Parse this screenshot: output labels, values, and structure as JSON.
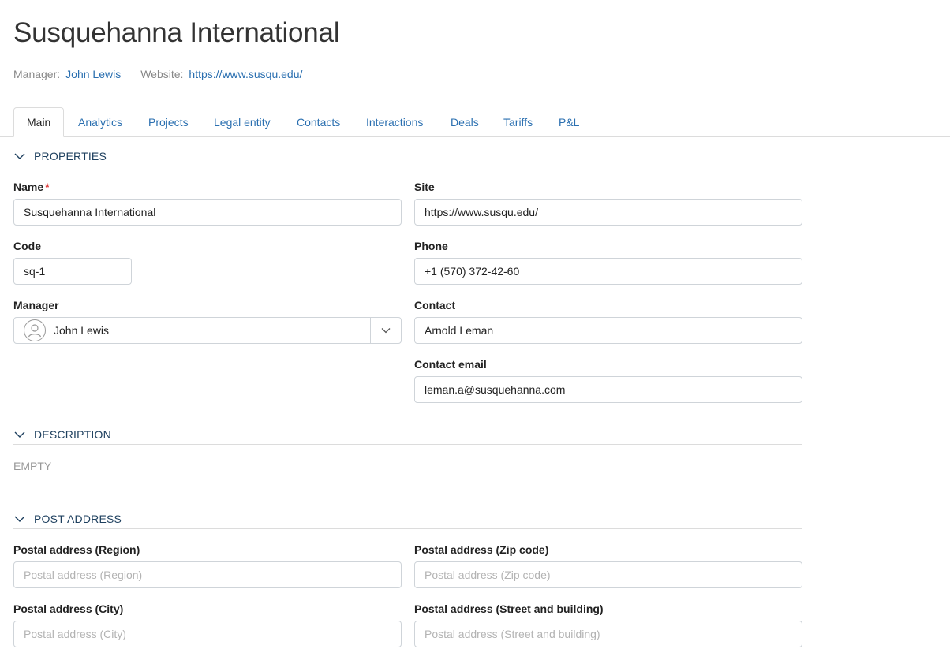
{
  "header": {
    "title": "Susquehanna International",
    "manager_label": "Manager:",
    "manager_value": "John Lewis",
    "website_label": "Website:",
    "website_value": "https://www.susqu.edu/"
  },
  "tabs": [
    "Main",
    "Analytics",
    "Projects",
    "Legal entity",
    "Contacts",
    "Interactions",
    "Deals",
    "Tariffs",
    "P&L"
  ],
  "properties": {
    "section_title": "PROPERTIES",
    "name_label": "Name",
    "name_required": "*",
    "name_value": "Susquehanna International",
    "site_label": "Site",
    "site_value": "https://www.susqu.edu/",
    "code_label": "Code",
    "code_value": "sq-1",
    "phone_label": "Phone",
    "phone_value": "+1 (570) 372-42-60",
    "manager_label": "Manager",
    "manager_value": "John Lewis",
    "contact_label": "Contact",
    "contact_value": "Arnold Leman",
    "contact_email_label": "Contact email",
    "contact_email_value": "leman.a@susquehanna.com"
  },
  "description": {
    "section_title": "DESCRIPTION",
    "empty_text": "EMPTY"
  },
  "post_address": {
    "section_title": "POST ADDRESS",
    "region_label": "Postal address (Region)",
    "region_placeholder": "Postal address (Region)",
    "zip_label": "Postal address (Zip code)",
    "zip_placeholder": "Postal address (Zip code)",
    "city_label": "Postal address (City)",
    "city_placeholder": "Postal address (City)",
    "street_label": "Postal address (Street and building)",
    "street_placeholder": "Postal address (Street and building)"
  },
  "colors": {
    "link": "#2a6fb0",
    "section_title": "#1d3f5e",
    "required": "#dd3333"
  }
}
